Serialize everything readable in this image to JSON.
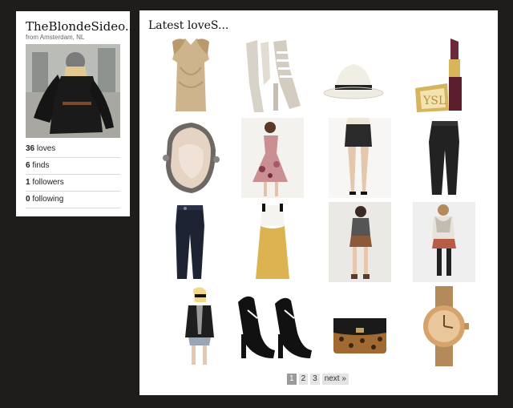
{
  "profile": {
    "name": "TheBlondeSideo...",
    "location": "from Amsterdam, NL",
    "stats": [
      {
        "count": "36",
        "label": "loves"
      },
      {
        "count": "6",
        "label": "finds"
      },
      {
        "count": "1",
        "label": "followers"
      },
      {
        "count": "0",
        "label": "following"
      }
    ]
  },
  "main": {
    "title": "Latest loveS...",
    "items": [
      {
        "icon": "draped-top-icon"
      },
      {
        "icon": "strappy-heels-icon"
      },
      {
        "icon": "fedora-hat-icon"
      },
      {
        "icon": "lipstick-icon"
      },
      {
        "icon": "quartz-ring-icon"
      },
      {
        "icon": "floral-dress-icon"
      },
      {
        "icon": "leather-skirt-icon"
      },
      {
        "icon": "black-trousers-icon"
      },
      {
        "icon": "navy-trousers-icon"
      },
      {
        "icon": "yellow-dress-icon"
      },
      {
        "icon": "shorts-outfit-icon"
      },
      {
        "icon": "scarf-outfit-icon"
      },
      {
        "icon": "blazer-outfit-icon"
      },
      {
        "icon": "platform-heels-icon"
      },
      {
        "icon": "leopard-clutch-icon"
      },
      {
        "icon": "gold-watch-icon"
      }
    ],
    "pagination": {
      "pages": [
        "1",
        "2",
        "3"
      ],
      "current": "1",
      "next_label": "next »"
    }
  }
}
